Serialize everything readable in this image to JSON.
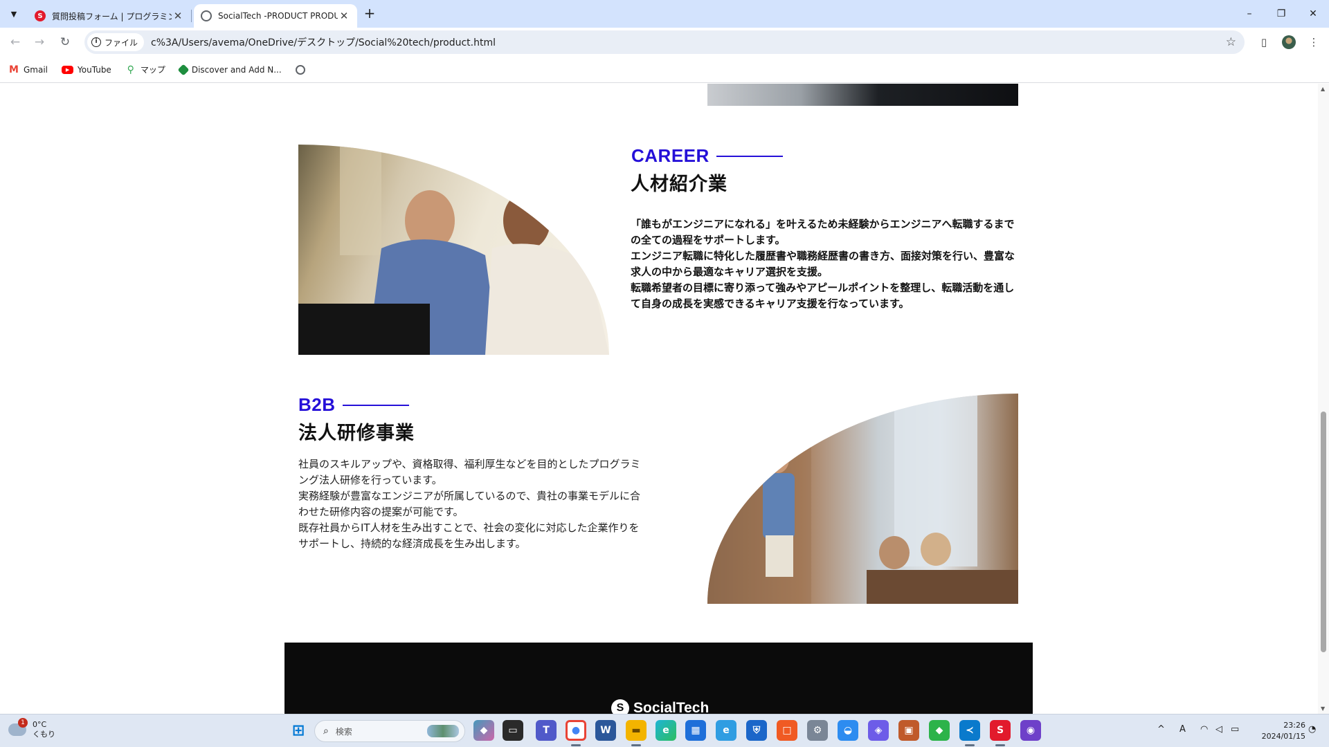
{
  "browser": {
    "tabs": [
      {
        "title": "質問投稿フォーム | プログラミング学",
        "active": false
      },
      {
        "title": "SocialTech -PRODUCT PRODUC",
        "active": true
      }
    ],
    "new_tab": "+",
    "window_controls": {
      "minimize": "–",
      "restore": "❐",
      "close": "✕"
    },
    "nav": {
      "back": "←",
      "forward": "→",
      "reload": "↻"
    },
    "address": {
      "chip": "ファイル",
      "url": "c%3A/Users/avema/OneDrive/デスクトップ/Social%20tech/product.html"
    },
    "bookmarks": [
      {
        "label": "Gmail",
        "icon": "gmail-icon"
      },
      {
        "label": "YouTube",
        "icon": "youtube-icon"
      },
      {
        "label": "マップ",
        "icon": "maps-icon"
      },
      {
        "label": "Discover and Add N...",
        "icon": "discover-icon"
      },
      {
        "label": "",
        "icon": "globe-icon"
      }
    ]
  },
  "page": {
    "career": {
      "label_en": "CAREER",
      "heading": "人材紹介業",
      "lines": [
        "「誰もがエンジニアになれる」を叶えるため未経験からエンジニアへ転職するまで",
        "の全ての過程をサポートします。",
        "エンジニア転職に特化した履歴書や職務経歴書の書き方、面接対策を行い、豊富な",
        "求人の中から最適なキャリア選択を支援。",
        "転職希望者の目標に寄り添って強みやアピールポイントを整理し、転職活動を通し",
        "て自身の成長を実感できるキャリア支援を行なっています。"
      ]
    },
    "b2b": {
      "label_en": "B2B",
      "heading": "法人研修事業",
      "lines": [
        "社員のスキルアップや、資格取得、福利厚生などを目的としたプログラミ",
        "ング法人研修を行っています。",
        "実務経験が豊富なエンジニアが所属しているので、貴社の事業モデルに合",
        "わせた研修内容の提案が可能です。",
        "既存社員からIT人材を生み出すことで、社会の変化に対応した企業作りを",
        "サポートし、持続的な経済成長を生み出します。"
      ]
    },
    "footer": {
      "logo_text": "SocialTech",
      "logo_mark": "S"
    }
  },
  "taskbar": {
    "weather": {
      "badge": "1",
      "temp": "0°C",
      "condition": "くもり"
    },
    "search_placeholder": "検索",
    "clock": {
      "time": "23:26",
      "date": "2024/01/15"
    },
    "ime": "A"
  },
  "colors": {
    "accent": "#2510d8",
    "footer_bg": "#0b0b0b",
    "tab_strip": "#d3e3fd"
  }
}
